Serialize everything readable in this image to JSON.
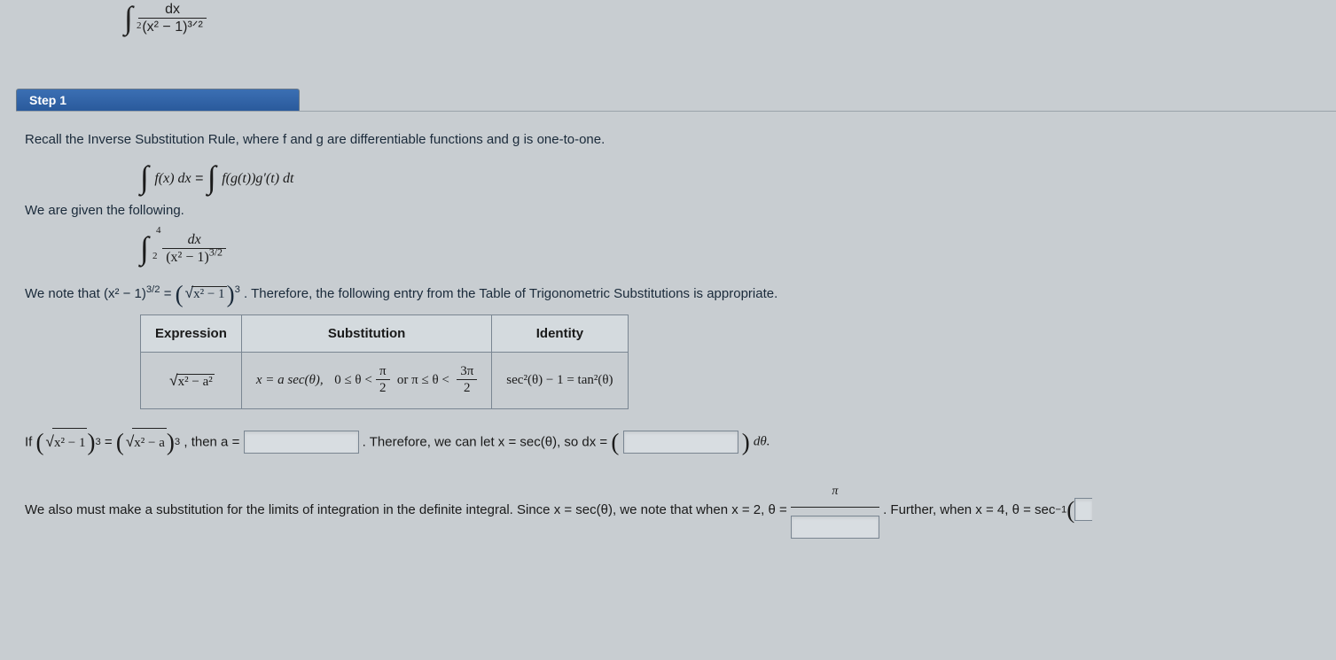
{
  "top_fragment": {
    "sub": "2",
    "num": "dx",
    "den": "(x² − 1)³ᐟ²"
  },
  "step": {
    "label": "Step 1"
  },
  "p1": "Recall the Inverse Substitution Rule, where f and g are differentiable functions and g is one-to-one.",
  "eq1": {
    "lhs": "f(x) dx",
    "rhs": "f(g(t))g′(t) dt"
  },
  "p2": "We are given the following.",
  "integral": {
    "lower": "2",
    "upper": "4",
    "num": "dx",
    "den_base": "(x² − 1)",
    "den_exp": "3/2"
  },
  "p3_a": "We note that (x² − 1)",
  "p3_exp1": "3/2",
  "p3_b": " = ",
  "p3_rad": "x² − 1",
  "p3_exp2": "3",
  "p3_c": ". Therefore, the following entry from the Table of Trigonometric Substitutions is appropriate.",
  "table": {
    "h1": "Expression",
    "h2": "Substitution",
    "h3": "Identity",
    "r1c1_rad": "x² − a²",
    "r1c2_a": "x = a sec(θ),",
    "r1c2_b": "0 ≤ θ <",
    "r1c2_frac1_num": "π",
    "r1c2_frac1_den": "2",
    "r1c2_c": "or π ≤ θ <",
    "r1c2_frac2_num": "3π",
    "r1c2_frac2_den": "2",
    "r1c3": "sec²(θ) − 1 = tan²(θ)"
  },
  "p4_a": "If ",
  "p4_rad1": "x² − 1",
  "p4_exp1": "3",
  "p4_b": " = ",
  "p4_rad2": "x² − a",
  "p4_exp2": "3",
  "p4_c": ", then a = ",
  "p4_d": ". Therefore, we can let x = sec(θ), so dx = ",
  "p4_e": "dθ.",
  "p5_a": "We also must make a substitution for the limits of integration in the definite integral. Since x = sec(θ), we note that when x = 2, θ = ",
  "p5_frac_num": "π",
  "p5_b": ". Further, when x = 4, θ = sec",
  "p5_exp": "−1"
}
